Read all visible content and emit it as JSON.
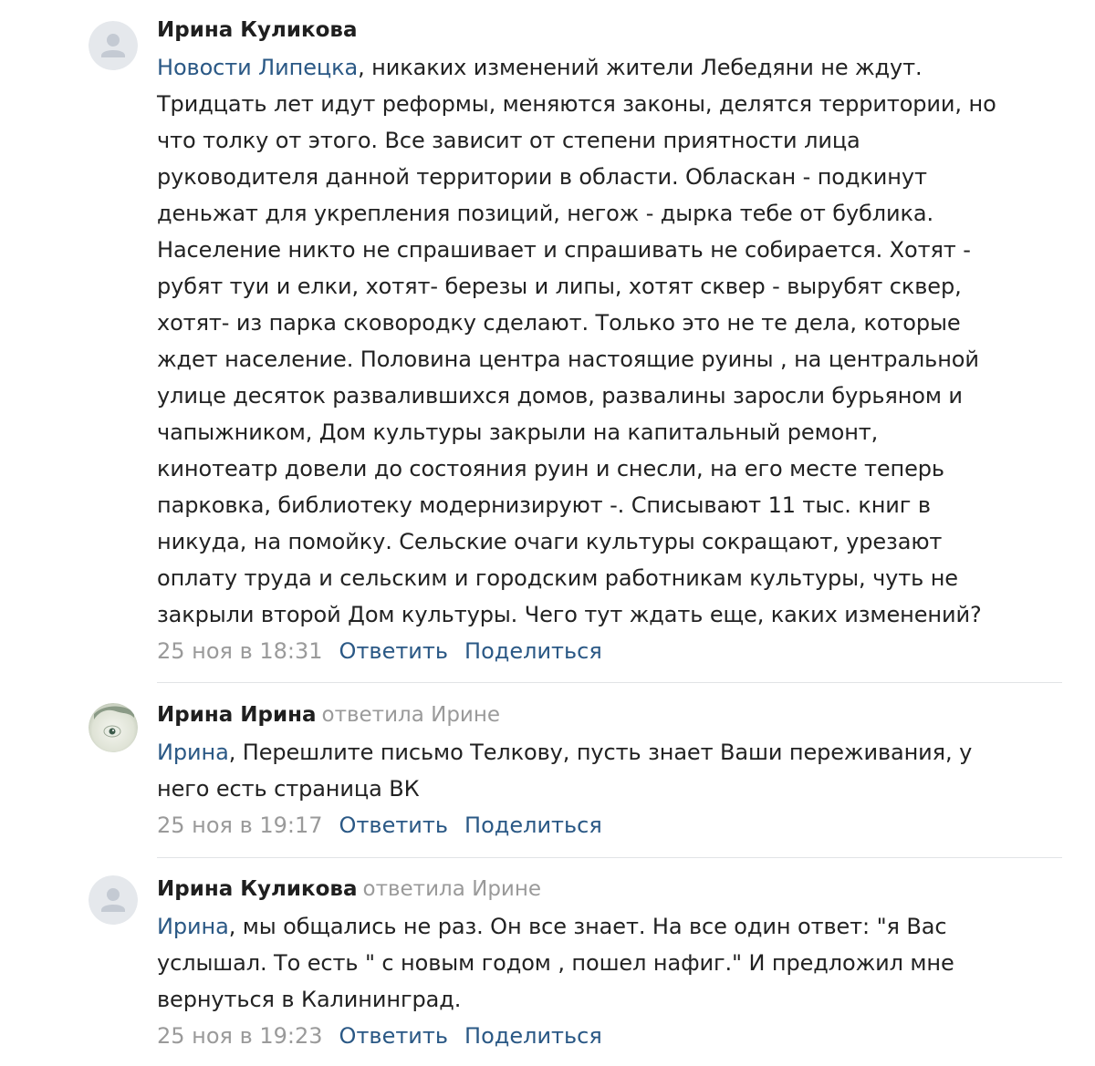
{
  "comments": [
    {
      "author": "Ирина Куликова",
      "replied_to": "",
      "avatar": "default-user-icon",
      "mention": "Новости Липецка",
      "lines": [
        ", никаких изменений жители Лебедяни не ждут.",
        "Тридцать лет идут реформы, меняются законы, делятся территории, но",
        "что толку от этого. Все зависит от степени приятности лица",
        "руководителя данной территории в области. Обласкан - подкинут",
        "деньжат для укрепления позиций, негож - дырка тебе от бублика.",
        "Население никто не спрашивает и спрашивать не собирается. Хотят -",
        "рубят туи и елки, хотят- березы и липы, хотят сквер - вырубят сквер,",
        "хотят- из парка сковородку сделают. Только это не те дела, которые",
        "ждет население. Половина центра настоящие руины , на центральной",
        "улице десяток развалившихся домов, развалины заросли бурьяном и",
        "чапыжником, Дом культуры закрыли на капитальный ремонт,",
        "кинотеатр довели до состояния руин и снесли, на его месте теперь",
        "парковка, библиотеку модернизируют -. Списывают 11 тыс. книг в",
        "никуда, на помойку. Сельские очаги культуры сокращают, урезают",
        "оплату труда и сельским и городским работникам культуры, чуть не",
        "закрыли второй Дом культуры. Чего тут ждать еще, каких изменений?"
      ],
      "date": "25 ноя в 18:31",
      "reply_label": "Ответить",
      "share_label": "Поделиться"
    },
    {
      "author": "Ирина Ирина",
      "replied_to": "ответила Ирине",
      "avatar": "user-photo-icon",
      "mention": "Ирина",
      "lines": [
        ", Перешлите письмо Телкову, пусть знает Ваши переживания, у",
        "него есть страница ВК"
      ],
      "date": "25 ноя в 19:17",
      "reply_label": "Ответить",
      "share_label": "Поделиться"
    },
    {
      "author": "Ирина Куликова",
      "replied_to": "ответила Ирине",
      "avatar": "default-user-icon",
      "mention": "Ирина",
      "lines": [
        ", мы общались не раз. Он все знает. На все один ответ: \"я Вас",
        "услышал. То есть \" с новым годом , пошел нафиг.\" И предложил мне",
        "вернуться в Калининград."
      ],
      "date": "25 ноя в 19:23",
      "reply_label": "Ответить",
      "share_label": "Поделиться"
    }
  ],
  "colors": {
    "link": "#2a5885",
    "muted": "#9a9a9a",
    "text": "#222222",
    "divider": "#e1e3e6",
    "avatar_bg": "#e5e8ec",
    "avatar_icon": "#c4cad3"
  }
}
